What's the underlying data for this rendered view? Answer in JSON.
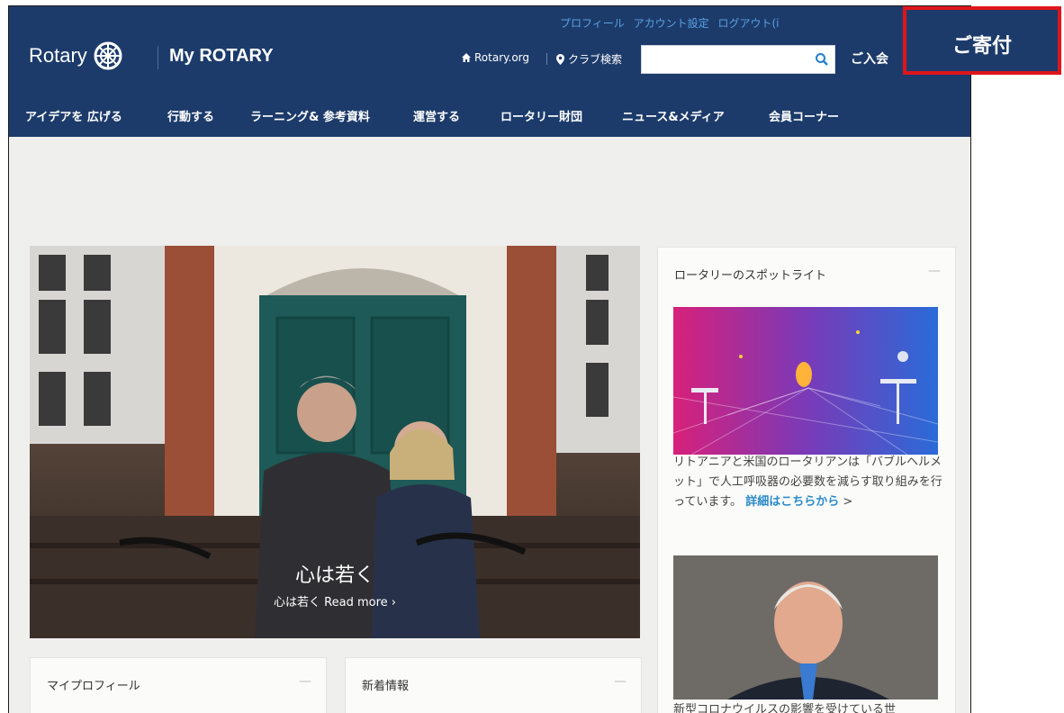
{
  "header": {
    "top_links": [
      "プロフィール",
      "アカウント設定",
      "ログアウト(i"
    ],
    "logo_text": "Rotary",
    "site_title": "My ROTARY",
    "rotary_org_link": "Rotary.org",
    "club_search_link": "クラブ検索",
    "search_placeholder": "",
    "join_label": "ご入会",
    "donate_label": "ご寄付"
  },
  "nav": {
    "items": [
      "アイデアを 広げる",
      "行動する",
      "ラーニング& 参考資料",
      "運営する",
      "ロータリー財団",
      "ニュース&メディア",
      "会員コーナー"
    ]
  },
  "hero": {
    "title": "心は若く",
    "link": "心は若く Read more ›"
  },
  "spotlight": {
    "title": "ロータリーのスポットライト",
    "collapse": "—",
    "story_text": "リトアニアと米国のロータリアンは「バブルヘルメット」で人工呼吸器の必要数を減らす取り組みを行っています。",
    "story_more": "詳細はこちらから",
    "story_arrow": " >",
    "second_story_text": "新型コロナウイルスの影響を受けている世"
  },
  "cards": {
    "profile_title": "マイプロフィール",
    "news_title": "新着情報",
    "collapse": "—"
  },
  "colors": {
    "header_bg": "#1c3b6b",
    "accent_link": "#2a8ac9",
    "donate_border": "#e0151c"
  }
}
